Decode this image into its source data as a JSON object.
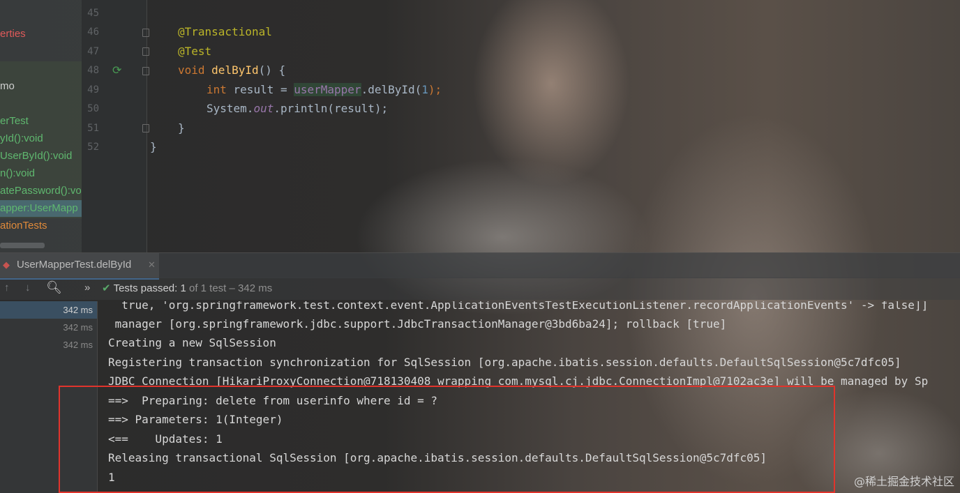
{
  "tree": {
    "items": [
      {
        "label": "erties",
        "color": "#e05a5a"
      },
      {
        "label": "mo",
        "color": "#d0d0d0"
      },
      {
        "label": "erTest",
        "color": "#5fb86f"
      },
      {
        "label": "yId():void",
        "color": "#5fb86f"
      },
      {
        "label": "UserById():void",
        "color": "#5fb86f"
      },
      {
        "label": "n():void",
        "color": "#5fb86f"
      },
      {
        "label": "atePassword():vo",
        "color": "#5fb86f"
      },
      {
        "label": "apper:UserMapp",
        "color": "#5fb86f"
      },
      {
        "label": "ationTests",
        "color": "#e08a3a"
      }
    ]
  },
  "editor": {
    "line_numbers": [
      "45",
      "46",
      "47",
      "48",
      "49",
      "50",
      "51",
      "52"
    ],
    "annotation1": "@Transactional",
    "annotation2": "@Test",
    "void_kw": "void",
    "method_name": "delById",
    "method_rest": "() {",
    "int_kw": "int",
    "result_decl": " result = ",
    "mapper_field": "userMapper",
    "call_part": ".delById(",
    "arg": "1",
    "call_end": ");",
    "sys": "System.",
    "out": "out",
    "println": ".println(result);",
    "close_method": "}",
    "close_class": "}"
  },
  "run_tab": {
    "label": "UserMapperTest.delById"
  },
  "toolbar": {
    "expand_label": "»",
    "passed_label": "Tests passed:",
    "passed_count": "1",
    "passed_detail": "of 1 test – 342 ms"
  },
  "test_times": [
    "342 ms",
    "342 ms",
    "342 ms"
  ],
  "console": {
    "lines": [
      "  true, 'org.springframework.test.context.event.ApplicationEventsTestExecutionListener.recordApplicationEvents' -> false]]",
      " manager [org.springframework.jdbc.support.JdbcTransactionManager@3bd6ba24]; rollback [true]",
      "Creating a new SqlSession",
      "Registering transaction synchronization for SqlSession [org.apache.ibatis.session.defaults.DefaultSqlSession@5c7dfc05]",
      "JDBC Connection [HikariProxyConnection@718130408 wrapping com.mysql.cj.jdbc.ConnectionImpl@7102ac3e] will be managed by Sp",
      "==>  Preparing: delete from userinfo where id = ?",
      "==> Parameters: 1(Integer)",
      "<==    Updates: 1",
      "Releasing transactional SqlSession [org.apache.ibatis.session.defaults.DefaultSqlSession@5c7dfc05]",
      "1"
    ]
  },
  "watermark": "@稀土掘金技术社区"
}
